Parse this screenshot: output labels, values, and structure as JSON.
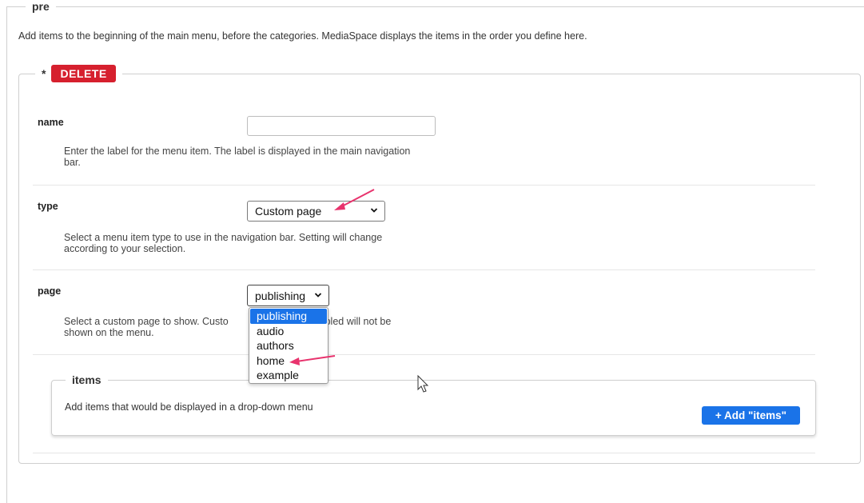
{
  "section": {
    "legend": "pre",
    "description": "Add items to the beginning of the main menu, before the categories. MediaSpace displays the items in the order you define here."
  },
  "item": {
    "required_marker": "*",
    "delete_label": "DELETE"
  },
  "fields": {
    "name": {
      "label": "name",
      "value": "",
      "help": "Enter the label for the menu item. The label is displayed in the main navigation bar."
    },
    "type": {
      "label": "type",
      "selected": "Custom page",
      "help": "Select a menu item type to use in the navigation bar. Setting will change according to your selection."
    },
    "page": {
      "label": "page",
      "selected": "publishing",
      "help_before": "Select a custom page to show. Custo",
      "help_after": "disabled will not be",
      "help_line2": "shown on the menu.",
      "options": [
        "publishing",
        "audio",
        "authors",
        "home",
        "example"
      ]
    }
  },
  "items": {
    "legend": "items",
    "description": "Add items that would be displayed in a drop-down menu",
    "add_label": "+ Add \"items\""
  },
  "colors": {
    "delete": "#d6202e",
    "accent": "#1a73e8",
    "annotation_arrow": "#e8336d"
  }
}
